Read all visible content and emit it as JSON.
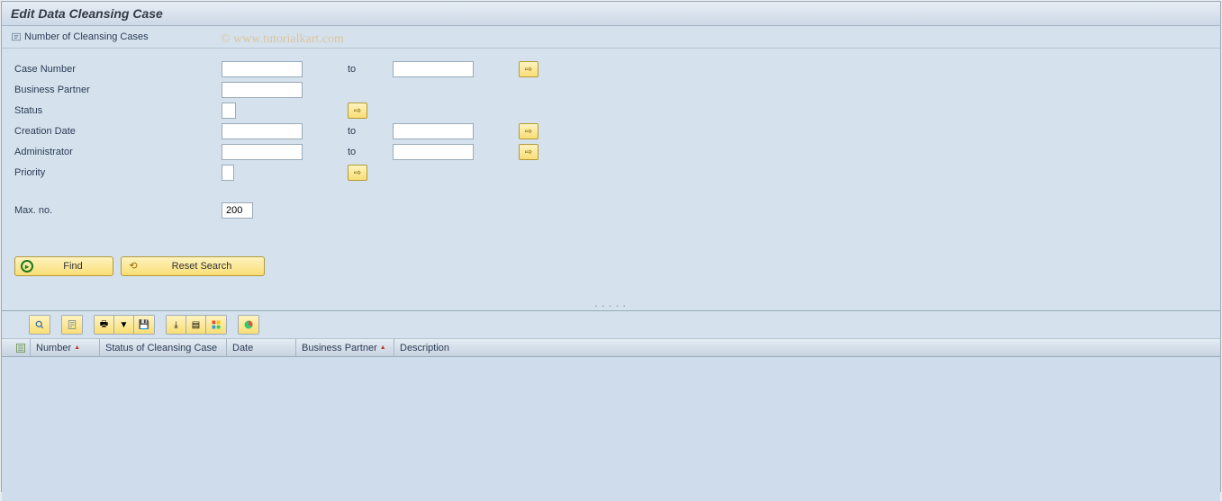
{
  "title": "Edit Data Cleansing Case",
  "topLink": {
    "label": "Number of Cleansing Cases"
  },
  "fields": {
    "caseNumber": {
      "label": "Case Number",
      "from": "",
      "toLabel": "to",
      "to": ""
    },
    "businessPartner": {
      "label": "Business Partner",
      "value": ""
    },
    "status": {
      "label": "Status",
      "value": ""
    },
    "creationDate": {
      "label": "Creation Date",
      "from": "",
      "toLabel": "to",
      "to": ""
    },
    "administrator": {
      "label": "Administrator",
      "from": "",
      "toLabel": "to",
      "to": ""
    },
    "priority": {
      "label": "Priority",
      "value": ""
    },
    "maxNo": {
      "label": "Max. no.",
      "value": "200"
    }
  },
  "buttons": {
    "find": "Find",
    "reset": "Reset Search"
  },
  "tableHeaders": {
    "number": "Number",
    "status": "Status of Cleansing Case",
    "date": "Date",
    "bp": "Business Partner",
    "desc": "Description"
  },
  "watermark": "© www.tutorialkart.com"
}
